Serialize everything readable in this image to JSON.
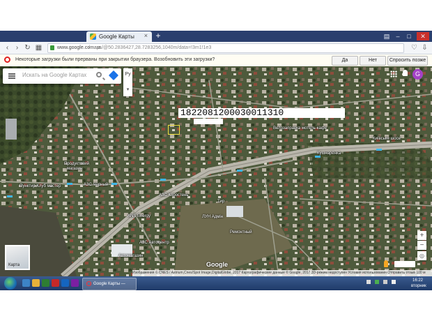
{
  "browser": {
    "tab_title": "Google Карты",
    "tab_close": "×",
    "new_tab": "+",
    "url_host": "www.google.com.ua",
    "url_path": "/maps/@50.2836427,28.7283256,1040m/data=!3m1!1e3"
  },
  "notification": {
    "text": "Некоторые загрузки были прерваны при закрытии браузера. Возобновить эти загрузки?",
    "yes": "Да",
    "no": "Нет",
    "ask_later": "Спросить позже"
  },
  "map": {
    "search_placeholder": "Искать на Google Картах",
    "language": "Ру",
    "avatar_letter": "G",
    "cadastral_number": "1822081200030011310",
    "thumb_label": "Карта",
    "logo": "Google",
    "zoom_in": "+",
    "zoom_out": "−",
    "labels": [
      "Велозаправка мотель-кафе",
      "Київське шосе",
      "Кушнарёнка",
      "Продуктовий",
      "магазин",
      "Пунктир Клуб мастер",
      "АЗС Чёрный",
      "АЗС Коростень",
      "Тир",
      "ЛУН Адмін",
      "Ремонтный",
      "ANS Energy",
      "АЗС Автоцентр",
      "Автомагазин"
    ],
    "footer": "Изображения © CNES / Astrium,Cnes/Spot Image,DigitalGlobe, 2017 Картографические данные © Google, 2017   3D-режим недоступен   Условия использования   Отправить отзыв   100 м"
  },
  "taskbar": {
    "task_label": "Google Карты — Opera",
    "time": "16:22",
    "day": "вторник"
  }
}
